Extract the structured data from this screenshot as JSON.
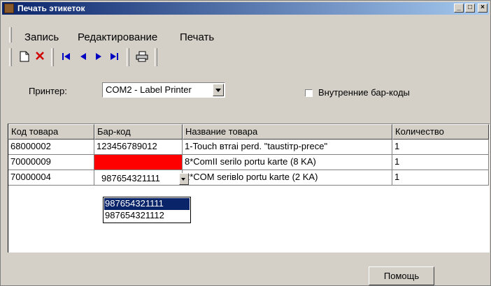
{
  "window": {
    "title": "Печать этикеток",
    "controls": {
      "minimize": "_",
      "maximize": "□",
      "close": "×"
    }
  },
  "menu": {
    "items": [
      "Запись",
      "Редактирование",
      "Печать"
    ]
  },
  "toolbar": {
    "buttons": [
      "new-icon",
      "delete-icon",
      "first-record-icon",
      "prev-record-icon",
      "next-record-icon",
      "last-record-icon",
      "printer-icon"
    ]
  },
  "printer": {
    "label": "Принтер:",
    "selected": "COM2 - Label Printer",
    "internal_barcodes_label": "Внутренние бар-коды",
    "internal_barcodes_checked": false
  },
  "table": {
    "headers": [
      "Код товара",
      "Бар-код",
      "Название товара",
      "Количество"
    ],
    "rows": [
      {
        "code": "68000002",
        "barcode": "123456789012",
        "name": "1-Touch втrai perd. \"taustітр-prece\"",
        "qty": "1"
      },
      {
        "code": "70000009",
        "barcode": "",
        "name": "8*ComІІ serilo portu karte (8 KA)",
        "qty": "1"
      },
      {
        "code": "70000004",
        "barcode": "987654321111",
        "name": "2*COM seriвlo portu karte (2 KA)",
        "qty": "1"
      }
    ],
    "dropdown_options": [
      "987654321111",
      "987654321112"
    ],
    "dropdown_selected": "987654321111"
  },
  "footer": {
    "help_label": "Помощь"
  },
  "colors": {
    "title_start": "#0a246a",
    "title_end": "#a6caf0",
    "invalid_cell": "#ff0000",
    "selection": "#0a246a"
  }
}
